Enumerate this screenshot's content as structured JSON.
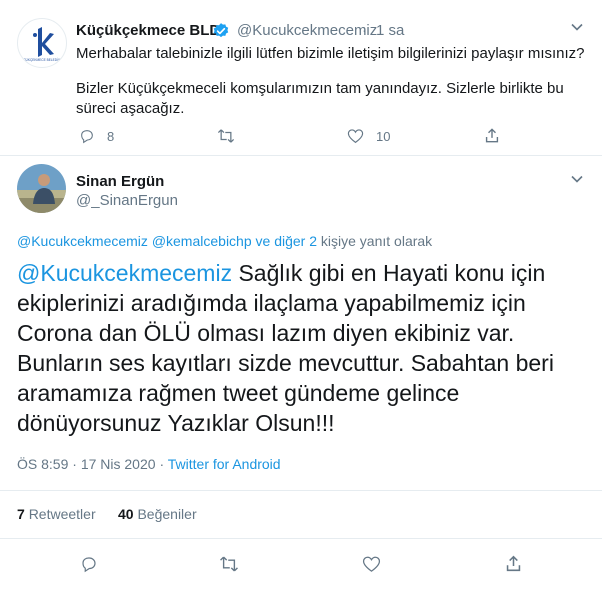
{
  "tweet1": {
    "display_name": "Küçükçekmece BLD",
    "handle": "@Kucukcekmecemiz",
    "separator": "·",
    "time": "1 sa",
    "line1": "Merhabalar talebinizle ilgili lütfen bizimle iletişim bilgilerinizi paylaşır mısınız?",
    "line2": "Bizler Küçükçekmeceli komşularımızın tam yanındayız. Sizlerle birlikte bu",
    "line3": "süreci aşacağız.",
    "reply_count": "8",
    "like_count": "10",
    "logo_text": "KÜÇÜKÇEKMECE BELEDİYESİ"
  },
  "tweet2": {
    "display_name": "Sinan Ergün",
    "handle": "@_SinanErgun",
    "reply_to_user1": "@Kucukcekmecemiz",
    "reply_to_user2": "@kemalcebichp",
    "reply_to_mid": "ve",
    "reply_to_others": "diğer 2",
    "reply_to_suffix": "kişiye yanıt olarak",
    "mention": "@Kucukcekmecemiz",
    "lines": [
      " Sağlık gibi en Hayati konu için",
      "ekiplerinizi aradığımda ilaçlama yapabilmemiz için",
      "Corona dan ÖLÜ olması lazım diyen ekibiniz var.",
      "Bunların ses kayıtları sizde mevcuttur. Sabahtan beri",
      "aramamıza rağmen tweet gündeme gelince",
      "dönüyorsunuz Yazıklar Olsun!!!"
    ],
    "time": "ÖS 8:59",
    "date_sep": "·",
    "date": "17 Nis 2020",
    "source_sep": "·",
    "source": "Twitter for Android",
    "retweets_count": "7",
    "retweets_label": "Retweetler",
    "likes_count": "40",
    "likes_label": "Beğeniler"
  },
  "colors": {
    "link": "#1b95e0",
    "verified": "#1da1f2",
    "muted": "#657786"
  }
}
